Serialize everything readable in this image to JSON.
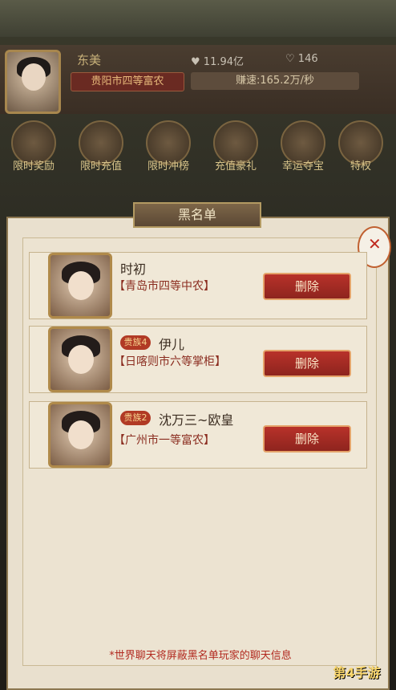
{
  "header": {
    "player_name": "东美",
    "player_rank": "贵阳市四等富农",
    "currency_amount": "11.94亿",
    "hearts": "146",
    "earn_speed": "赚速:165.2万/秒"
  },
  "icons": [
    {
      "label": "限时奖励",
      "icon": "gift-icon"
    },
    {
      "label": "限时充值",
      "icon": "treasure-icon"
    },
    {
      "label": "限时冲榜",
      "icon": "coin-icon"
    },
    {
      "label": "充值豪礼",
      "icon": "chest-icon"
    },
    {
      "label": "幸运夺宝",
      "icon": "pavilion-icon"
    },
    {
      "label": "特权",
      "icon": "book-icon"
    }
  ],
  "panel": {
    "title": "黑名单",
    "entries": [
      {
        "name": "时初",
        "rank": "【青岛市四等中农】",
        "badge": "",
        "button": "删除"
      },
      {
        "name": "伊儿",
        "rank": "【日喀则市六等掌柜】",
        "badge": "贵族4",
        "button": "删除"
      },
      {
        "name": "沈万三~欧皇",
        "rank": "【广州市一等富农】",
        "badge": "贵族2",
        "button": "删除"
      }
    ],
    "footer_note": "*世界聊天将屏蔽黑名单玩家的聊天信息"
  },
  "watermark": "第4手游"
}
